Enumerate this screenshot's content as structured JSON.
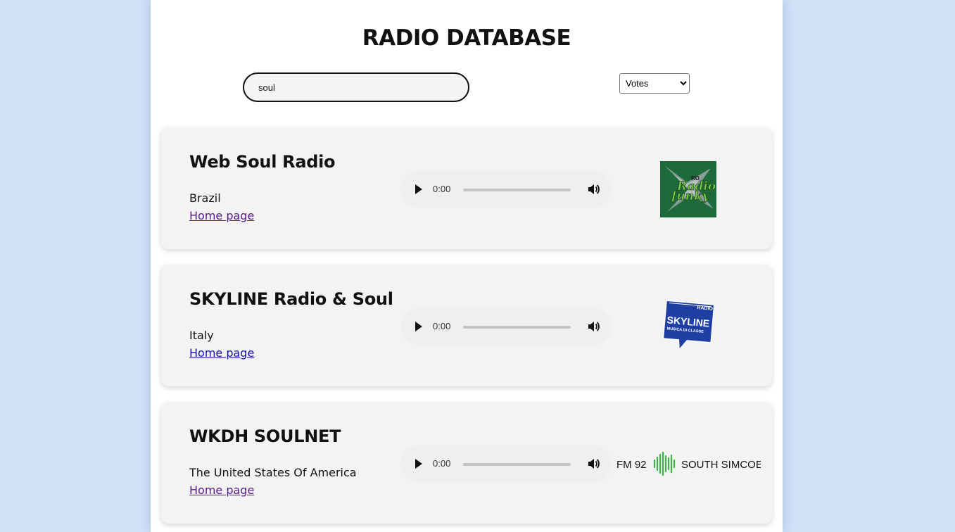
{
  "header": {
    "title": "RADIO DATABASE"
  },
  "search": {
    "value": "soul"
  },
  "sort": {
    "selected": "Votes",
    "options": [
      "Votes"
    ]
  },
  "stations": [
    {
      "name": "Web Soul Radio",
      "country": "Brazil",
      "home_label": "Home page",
      "player_time": "0:00",
      "logo": {
        "icon": "radio-funky-logo",
        "text_top": "RO",
        "text_main": "Radio",
        "text_sub": "funky"
      }
    },
    {
      "name": "SKYLINE Radio & Soul",
      "country": "Italy",
      "home_label": "Home page",
      "player_time": "0:00",
      "logo": {
        "icon": "skyline-logo",
        "text_top": "RADIO",
        "text_main": "SKYLINE",
        "text_sub": "MUSICA DI CLASSE"
      }
    },
    {
      "name": "WKDH SOULNET",
      "country": "The United States Of America",
      "home_label": "Home page",
      "player_time": "0:00",
      "logo": {
        "icon": "fm92-logo",
        "text_left": "FM 92",
        "text_right": "SOUTH SIMCOE"
      }
    }
  ],
  "colors": {
    "background": "#d1e2f8",
    "card": "#f3f3f4",
    "link_visited": "#551a8b",
    "link": "#1a0dab",
    "skyline_blue": "#1f3fa3",
    "funky_green": "#1d6b3a",
    "fm_green": "#3db34a"
  }
}
